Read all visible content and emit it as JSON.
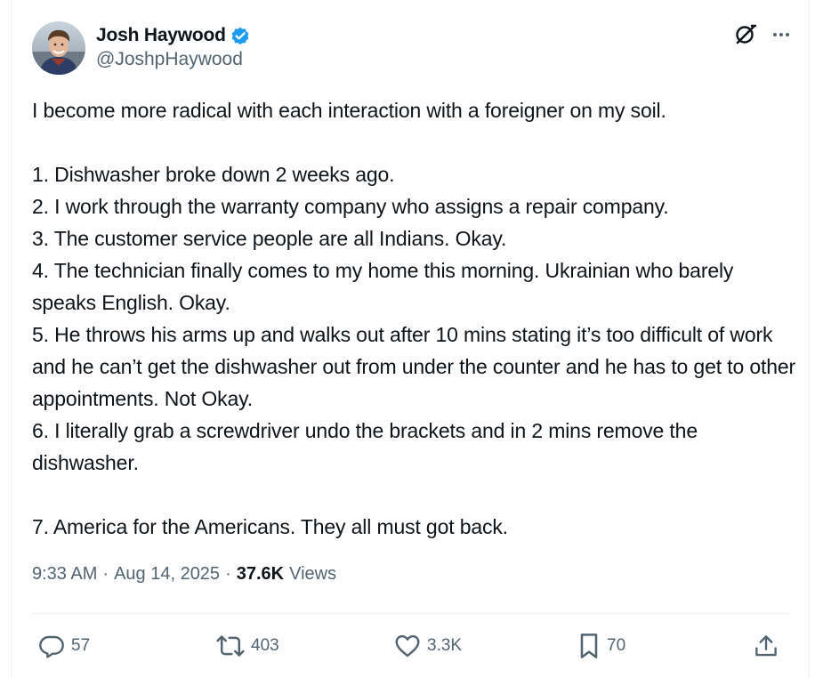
{
  "author": {
    "display_name": "Josh Haywood",
    "handle": "@JoshpHaywood",
    "verified_icon": "verified-badge-icon"
  },
  "tweet": {
    "lines": [
      "I become more radical with each interaction with a foreigner on my soil.",
      "",
      "1. Dishwasher broke down 2 weeks ago.",
      "2. I work through the warranty company who assigns a repair company.",
      "3. The customer service people are all Indians. Okay.",
      "4. The technician finally comes to my home this morning. Ukrainian who barely speaks English. Okay.",
      "5. He throws his arms up and walks out after 10 mins stating it’s too difficult of work and he can’t get the dishwasher out from under the counter and he has to get to other appointments. Not Okay.",
      "6. I literally grab a screwdriver undo the brackets and in 2 mins remove the dishwasher.",
      "",
      "7. America for the Americans. They all must got back."
    ]
  },
  "meta": {
    "time": "9:33 AM",
    "sep1": "·",
    "date": "Aug 14, 2025",
    "sep2": "·",
    "views_count": "37.6K",
    "views_label": "Views"
  },
  "actions": {
    "replies": "57",
    "reposts": "403",
    "likes": "3.3K",
    "bookmarks": "70"
  },
  "colors": {
    "text": "#0f1419",
    "secondary": "#536471",
    "verified": "#1d9bf0",
    "divider": "#eff3f4"
  }
}
